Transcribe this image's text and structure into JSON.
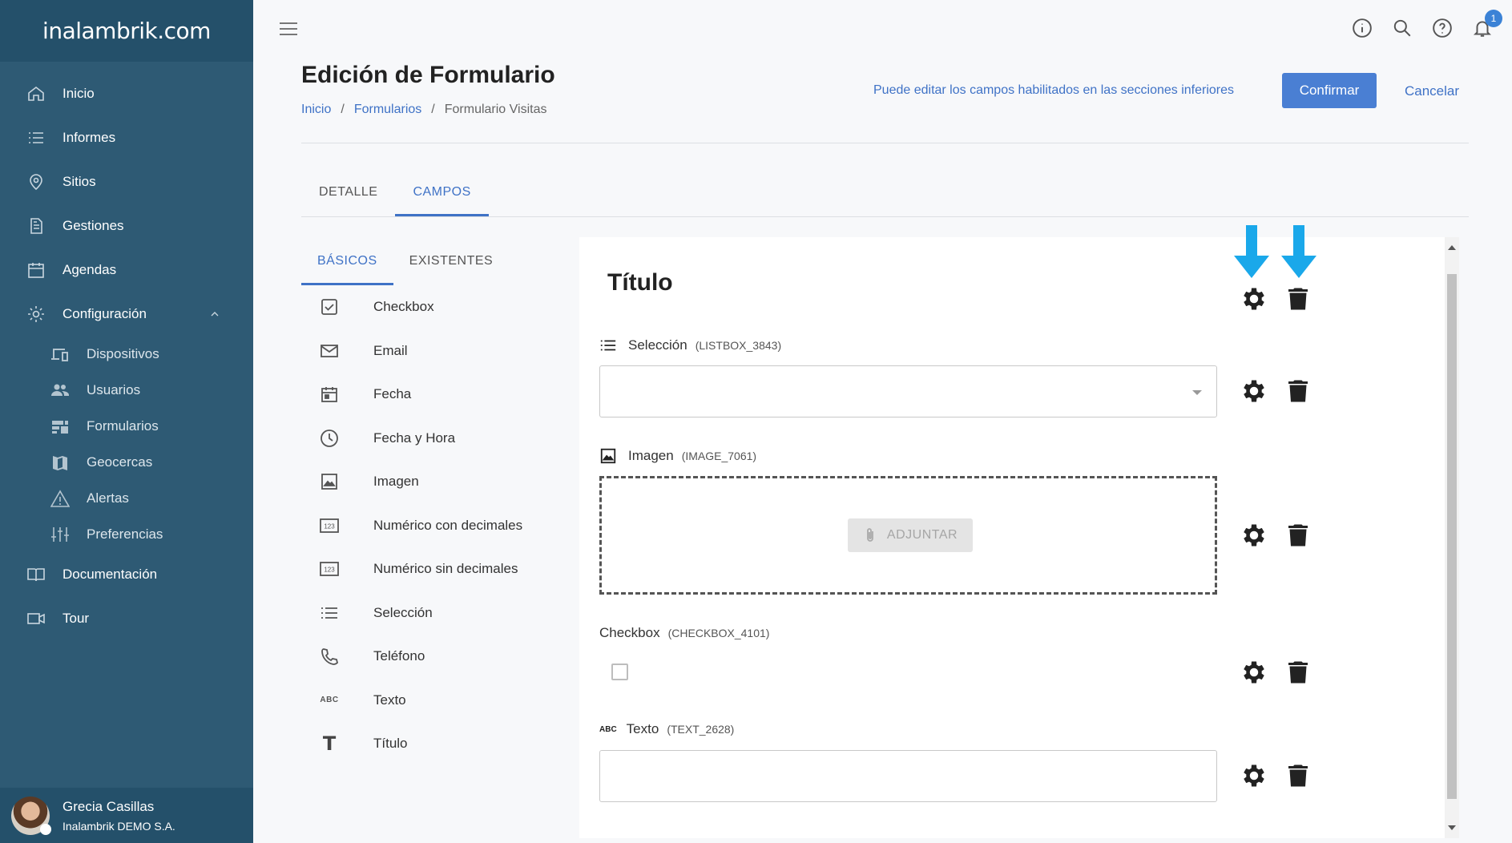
{
  "brand": {
    "logo_text": "inalambrik.com"
  },
  "sidebar": {
    "items": [
      {
        "label": "Inicio",
        "icon": "home-icon"
      },
      {
        "label": "Informes",
        "icon": "list-icon"
      },
      {
        "label": "Sitios",
        "icon": "location-pin-icon"
      },
      {
        "label": "Gestiones",
        "icon": "document-icon"
      },
      {
        "label": "Agendas",
        "icon": "calendar-icon"
      },
      {
        "label": "Configuración",
        "icon": "gear-icon"
      }
    ],
    "subitems": [
      {
        "label": "Dispositivos",
        "icon": "devices-icon"
      },
      {
        "label": "Usuarios",
        "icon": "users-icon"
      },
      {
        "label": "Formularios",
        "icon": "forms-icon"
      },
      {
        "label": "Geocercas",
        "icon": "map-icon"
      },
      {
        "label": "Alertas",
        "icon": "warning-icon"
      },
      {
        "label": "Preferencias",
        "icon": "sliders-icon"
      }
    ],
    "bottom_items": [
      {
        "label": "Documentación",
        "icon": "book-icon"
      },
      {
        "label": "Tour",
        "icon": "video-icon"
      }
    ]
  },
  "user": {
    "name": "Grecia Casillas",
    "org": "Inalambrik DEMO S.A."
  },
  "notifications": {
    "count": "1"
  },
  "header": {
    "title": "Edición de Formulario",
    "breadcrumb": [
      "Inicio",
      "Formularios",
      "Formulario Visitas"
    ],
    "separator": "/",
    "hint": "Puede editar los campos habilitados en las secciones inferiores",
    "confirm_label": "Confirmar",
    "cancel_label": "Cancelar"
  },
  "tabs": [
    {
      "label": "DETALLE",
      "active": false
    },
    {
      "label": "CAMPOS",
      "active": true
    }
  ],
  "subtabs": [
    {
      "label": "BÁSICOS",
      "active": true
    },
    {
      "label": "EXISTENTES",
      "active": false
    }
  ],
  "field_types": [
    {
      "label": "Checkbox",
      "icon": "checkbox-icon"
    },
    {
      "label": "Email",
      "icon": "mail-icon"
    },
    {
      "label": "Fecha",
      "icon": "calendar-icon"
    },
    {
      "label": "Fecha y Hora",
      "icon": "clock-icon"
    },
    {
      "label": "Imagen",
      "icon": "image-icon"
    },
    {
      "label": "Numérico con decimales",
      "icon": "number-icon",
      "glyph": "123"
    },
    {
      "label": "Numérico sin decimales",
      "icon": "number-icon",
      "glyph": "123"
    },
    {
      "label": "Selección",
      "icon": "list-icon"
    },
    {
      "label": "Teléfono",
      "icon": "phone-icon"
    },
    {
      "label": "Texto",
      "icon": "abc-icon",
      "glyph": "ABC"
    },
    {
      "label": "Título",
      "icon": "title-icon",
      "glyph": "T"
    }
  ],
  "form": {
    "title": "Título",
    "fields": [
      {
        "label": "Selección",
        "code": "(LISTBOX_3843)",
        "type": "select",
        "value": ""
      },
      {
        "label": "Imagen",
        "code": "(IMAGE_7061)",
        "type": "image",
        "button_label": "ADJUNTAR"
      },
      {
        "label": "Checkbox",
        "code": "(CHECKBOX_4101)",
        "type": "checkbox",
        "checked": false
      },
      {
        "label": "Texto",
        "code": "(TEXT_2628)",
        "type": "text",
        "value": "",
        "glyph": "ABC"
      }
    ]
  },
  "colors": {
    "sidebar_bg": "#2e5a74",
    "accent": "#4a7fd3",
    "link": "#3f72c6",
    "arrow": "#1aa8ea"
  }
}
